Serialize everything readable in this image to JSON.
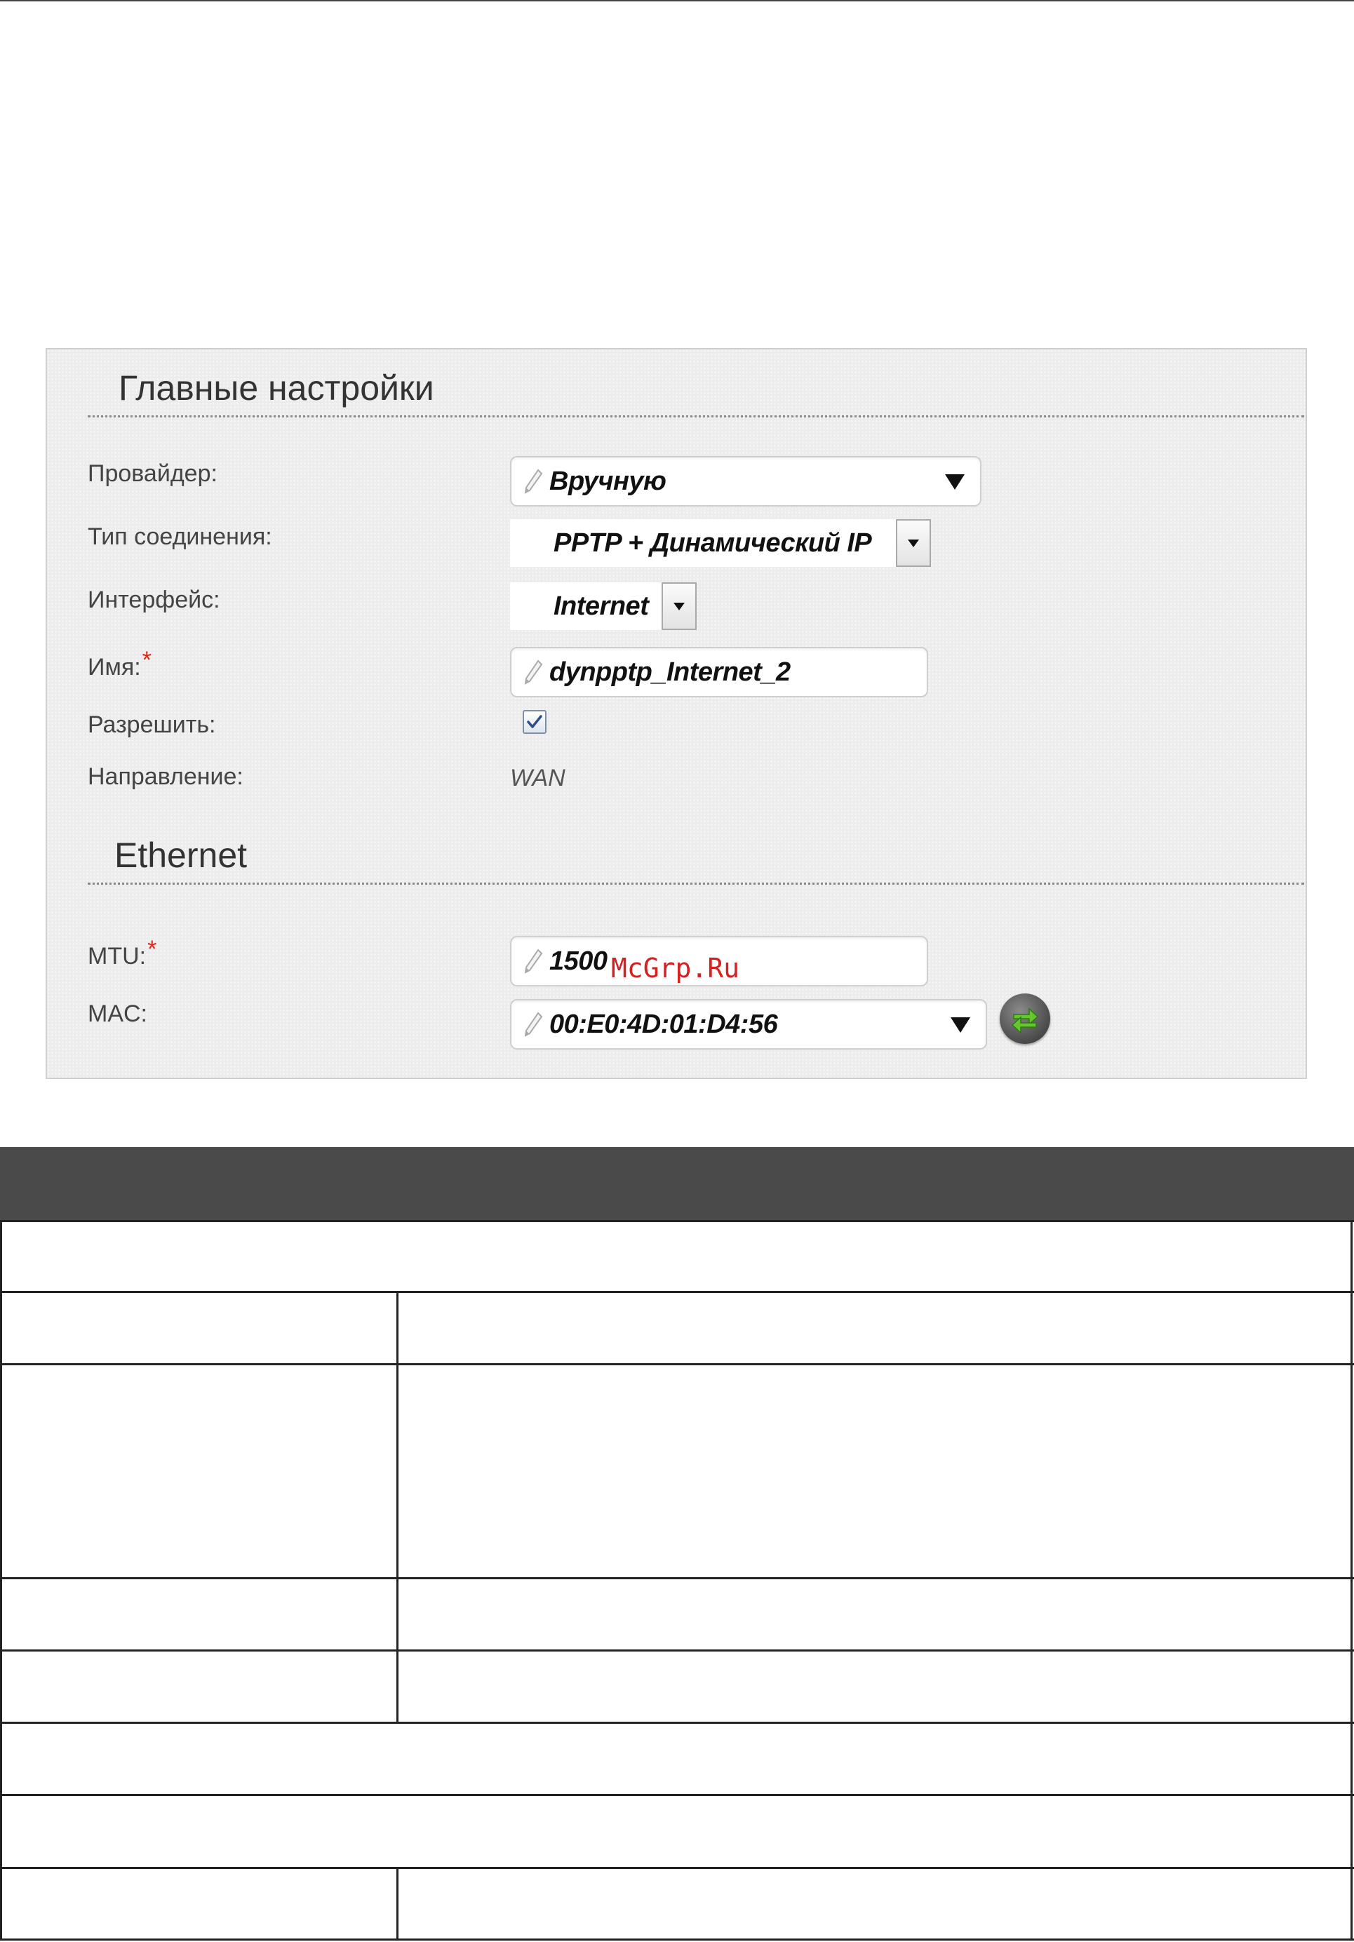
{
  "panel": {
    "main_settings_title": "Главные настройки",
    "ethernet_title": "Ethernet",
    "fields": {
      "provider_label": "Провайдер:",
      "provider_value": "Вручную",
      "connection_type_label": "Тип соединения:",
      "connection_type_value": "PPTP + Динамический IP",
      "interface_label": "Интерфейс:",
      "interface_value": "Internet",
      "name_label": "Имя:",
      "name_value": "dynpptp_Internet_2",
      "enable_label": "Разрешить:",
      "enable_checked": true,
      "direction_label": "Направление:",
      "direction_value": "WAN",
      "mtu_label": "MTU:",
      "mtu_value": "1500",
      "mac_label": "MAC:",
      "mac_value": "00:E0:4D:01:D4:56"
    },
    "required_mark": "*",
    "watermark": "McGrp.Ru"
  },
  "colors": {
    "panel_bg": "#ececec",
    "table_header_bg": "#4a4a4a",
    "required_red": "#e0251b",
    "refresh_arrow_green": "#5fbf2a"
  },
  "icons": {
    "pencil": "pencil-icon",
    "dropdown": "dropdown-arrow-icon",
    "checkbox": "checkmark-icon",
    "refresh": "refresh-arrows-icon"
  }
}
